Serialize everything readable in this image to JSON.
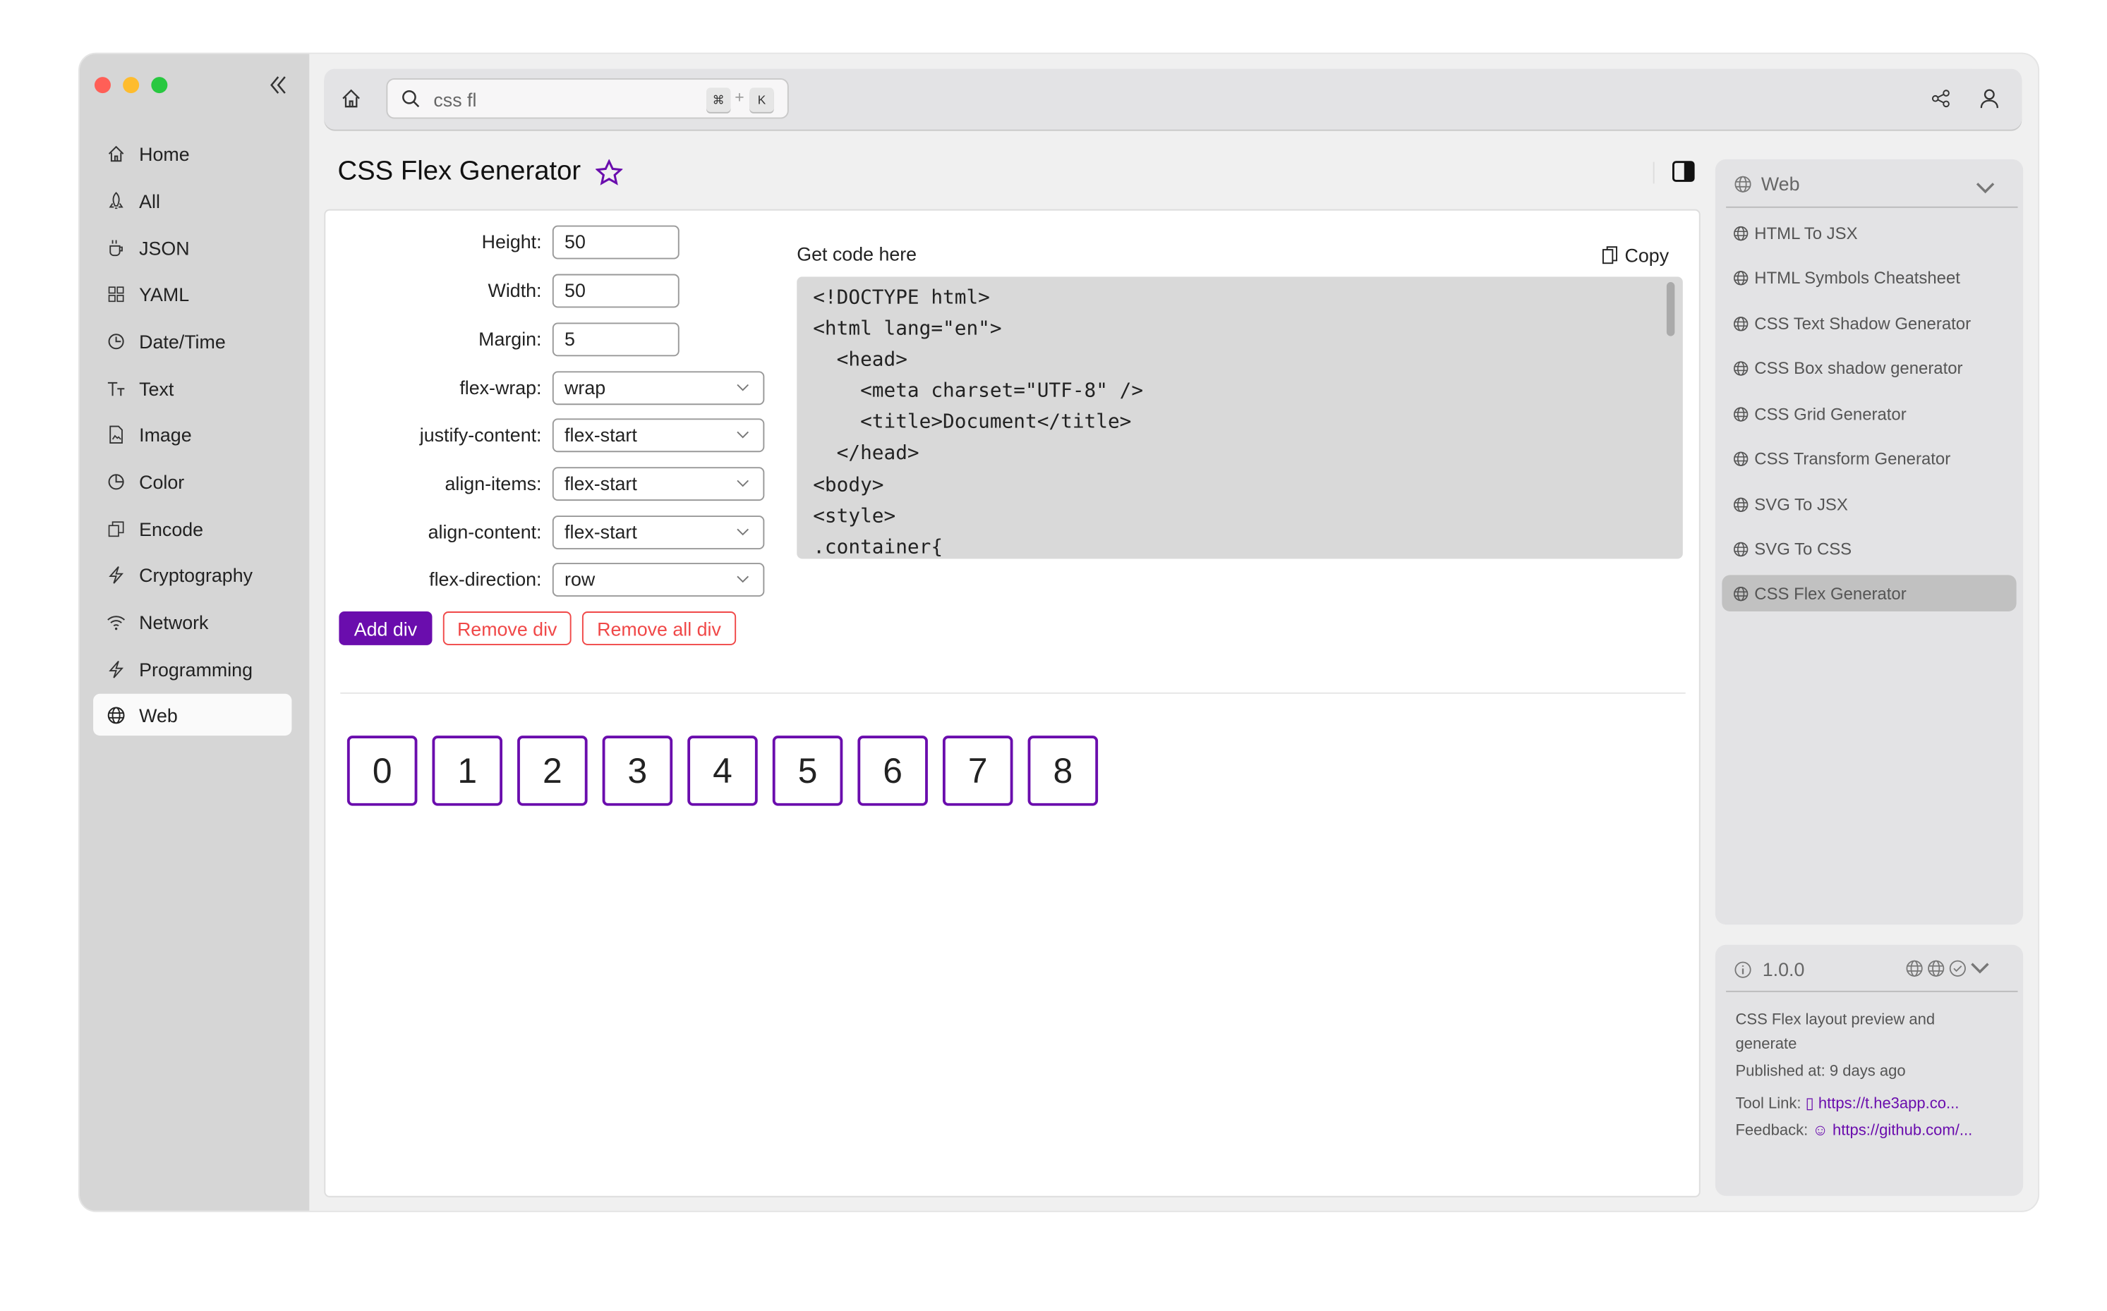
{
  "window": {
    "traffic_lights": [
      "#ff5f57",
      "#febc2e",
      "#28c840"
    ]
  },
  "sidebar": {
    "items": [
      {
        "label": "Home",
        "icon": "home-icon"
      },
      {
        "label": "All",
        "icon": "rocket-icon"
      },
      {
        "label": "JSON",
        "icon": "cup-icon"
      },
      {
        "label": "YAML",
        "icon": "grid-icon"
      },
      {
        "label": "Date/Time",
        "icon": "clock-icon"
      },
      {
        "label": "Text",
        "icon": "text-icon"
      },
      {
        "label": "Image",
        "icon": "image-file-icon"
      },
      {
        "label": "Color",
        "icon": "palette-icon"
      },
      {
        "label": "Encode",
        "icon": "copy-icon"
      },
      {
        "label": "Cryptography",
        "icon": "bolt-icon"
      },
      {
        "label": "Network",
        "icon": "wifi-icon"
      },
      {
        "label": "Programming",
        "icon": "bolt-icon"
      },
      {
        "label": "Web",
        "icon": "globe-icon",
        "selected": true
      }
    ]
  },
  "topbar": {
    "search_value": "css fl",
    "shortcut_mod": "⌘",
    "shortcut_plus": "+",
    "shortcut_key": "K"
  },
  "page": {
    "title": "CSS Flex Generator"
  },
  "form": {
    "fields": [
      {
        "label": "Height:",
        "value": "50"
      },
      {
        "label": "Width:",
        "value": "50"
      },
      {
        "label": "Margin:",
        "value": "5"
      }
    ],
    "selects": [
      {
        "label": "flex-wrap:",
        "value": "wrap"
      },
      {
        "label": "justify-content:",
        "value": "flex-start"
      },
      {
        "label": "align-items:",
        "value": "flex-start"
      },
      {
        "label": "align-content:",
        "value": "flex-start"
      },
      {
        "label": "flex-direction:",
        "value": "row"
      }
    ],
    "add_label": "Add div",
    "remove_label": "Remove div",
    "remove_all_label": "Remove all div"
  },
  "code": {
    "heading": "Get code here",
    "copy_label": "Copy",
    "text": "<!DOCTYPE html>\n<html lang=\"en\">\n  <head>\n    <meta charset=\"UTF-8\" />\n    <title>Document</title>\n  </head>\n<body>\n<style>\n.container{"
  },
  "preview": {
    "boxes": [
      "0",
      "1",
      "2",
      "3",
      "4",
      "5",
      "6",
      "7",
      "8"
    ]
  },
  "category": {
    "title": "Web",
    "items": [
      "HTML To JSX",
      "HTML Symbols Cheatsheet",
      "CSS Text Shadow Generator",
      "CSS Box shadow generator",
      "CSS Grid Generator",
      "CSS Transform Generator",
      "SVG To JSX",
      "SVG To CSS",
      "CSS Flex Generator"
    ],
    "selected": "CSS Flex Generator"
  },
  "info": {
    "version": "1.0.0",
    "description": "CSS Flex layout preview and generate",
    "published": "Published at: 9 days ago",
    "tool_link_label": "Tool Link:",
    "tool_link": "https://t.he3app.co...",
    "feedback_label": "Feedback:",
    "feedback_link": "https://github.com/..."
  },
  "colors": {
    "accent": "#6a0dad",
    "danger": "#f04848"
  }
}
